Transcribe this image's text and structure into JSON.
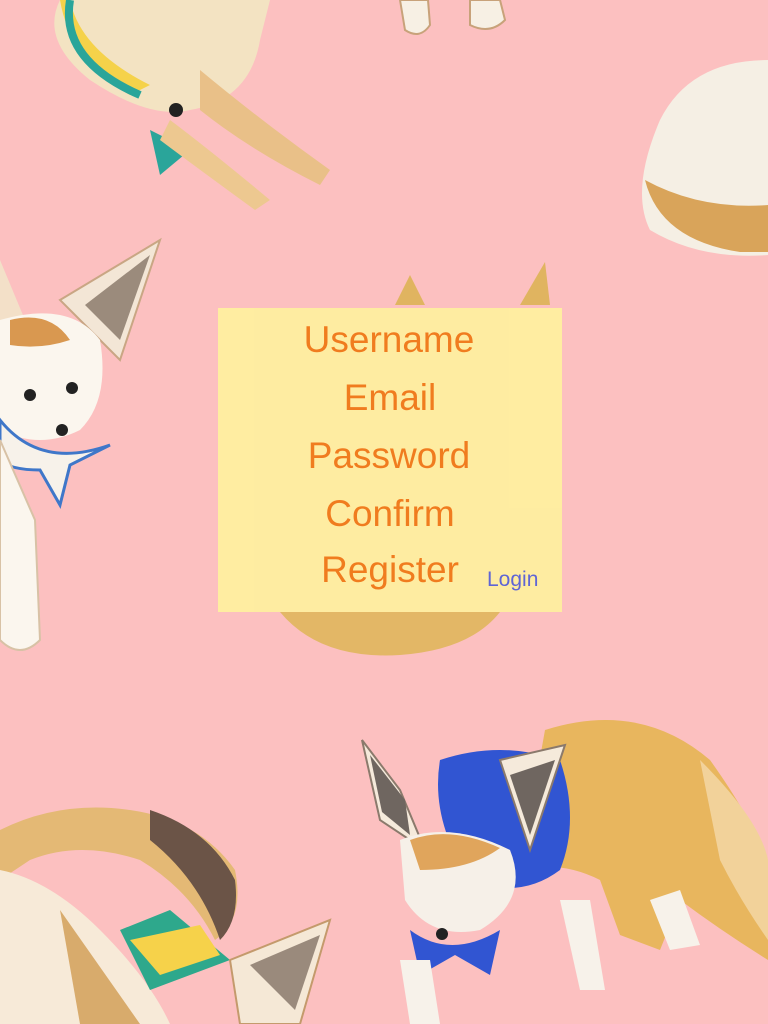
{
  "background": {
    "color": "#fcc0c0",
    "illustration": "fennec-fox-watercolor-pattern"
  },
  "form": {
    "panel_color": "#ffeea0",
    "text_color": "#f07a1a",
    "link_color": "#5a63d6",
    "username_label": "Username",
    "email_label": "Email",
    "password_label": "Password",
    "confirm_label": "Confirm",
    "register_label": "Register",
    "login_label": "Login"
  }
}
